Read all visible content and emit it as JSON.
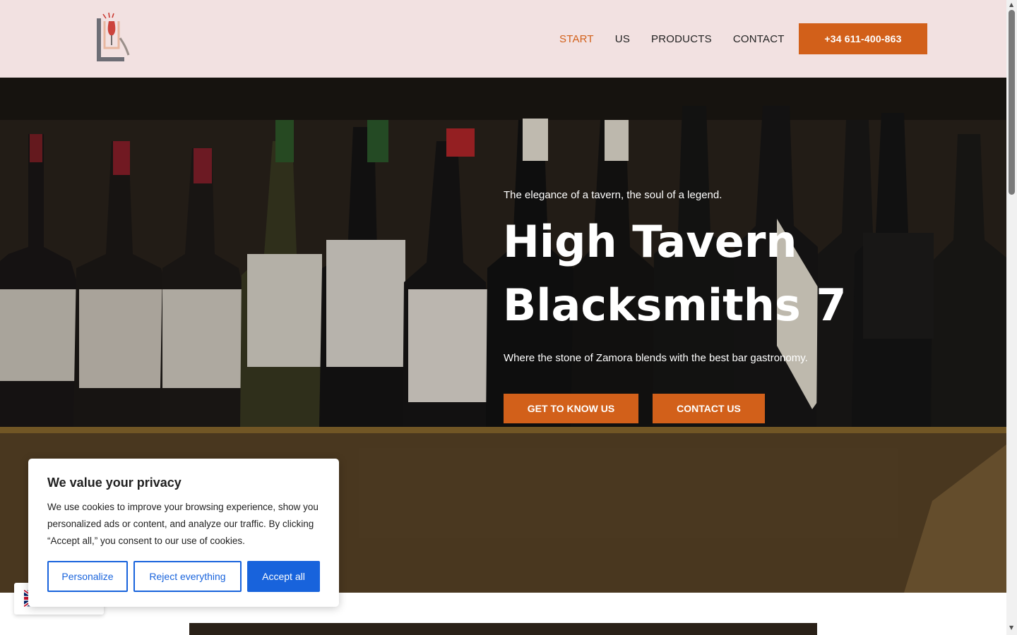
{
  "header": {
    "logo_icon": "tavern-logo-icon",
    "nav": {
      "start": "START",
      "us": "US",
      "products": "PRODUCTS",
      "contact": "CONTACT"
    },
    "active_nav": "START",
    "phone_button": "+34 611-400-863"
  },
  "hero": {
    "tagline": "The elegance of a tavern, the soul of a legend.",
    "title_line1": "High Tavern",
    "title_line2": "Blacksmiths 7",
    "subtitle": "Where the stone of Zamora blends with the best bar gastronomy.",
    "buttons": {
      "know_us": "GET TO KNOW US",
      "contact_us": "CONTACT US"
    },
    "background_image": "wine-bottles-shelf-photo"
  },
  "cookie_banner": {
    "title": "We value your privacy",
    "text": "We use cookies to improve your browsing experience, show you personalized ads or content, and analyze our traffic. By clicking “Accept all,” you consent to our use of cookies.",
    "buttons": {
      "personalize": "Personalize",
      "reject": "Reject everything",
      "accept": "Accept all"
    }
  },
  "language_switcher": {
    "flag_icon": "uk-flag-icon"
  },
  "colors": {
    "accent": "#d2601a",
    "header_bg": "#f2e1e1",
    "cookie_primary": "#1863dc",
    "text_dark": "#222222"
  }
}
